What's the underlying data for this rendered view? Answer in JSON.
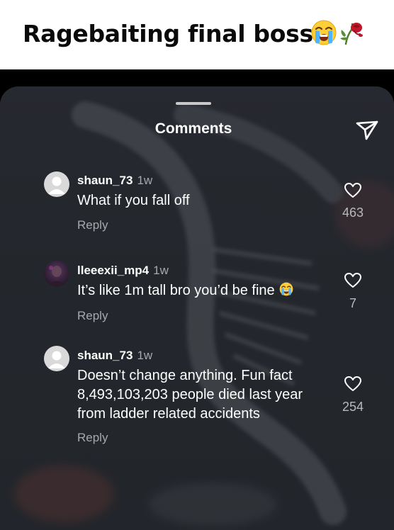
{
  "caption": {
    "text": "Ragebaiting final boss",
    "emoji": [
      "loudly-crying-face",
      "wilted-rose"
    ]
  },
  "sheet": {
    "title": "Comments",
    "share_icon": "paper-plane-icon"
  },
  "comments": [
    {
      "username": "shaun_73",
      "time": "1w",
      "lines": [
        "What if you fall off"
      ],
      "reply_label": "Reply",
      "likes": "463",
      "avatar": "default-avatar-icon"
    },
    {
      "username": "lleeexii_mp4",
      "time": "1w",
      "lines": [
        "It’s like 1m tall bro you’d be fine"
      ],
      "trailing_emoji": "loudly-crying-face",
      "reply_label": "Reply",
      "likes": "7",
      "avatar": "profile-photo"
    },
    {
      "username": "shaun_73",
      "time": "1w",
      "lines": [
        "Doesn’t change anything. Fun fact",
        "8,493,103,203 people died last year",
        "from ladder related accidents"
      ],
      "reply_label": "Reply",
      "likes": "254",
      "avatar": "default-avatar-icon"
    }
  ],
  "colors": {
    "sheet_background": "#25282e",
    "primary_text": "#ffffff",
    "secondary_text": "#a8a8ad"
  }
}
